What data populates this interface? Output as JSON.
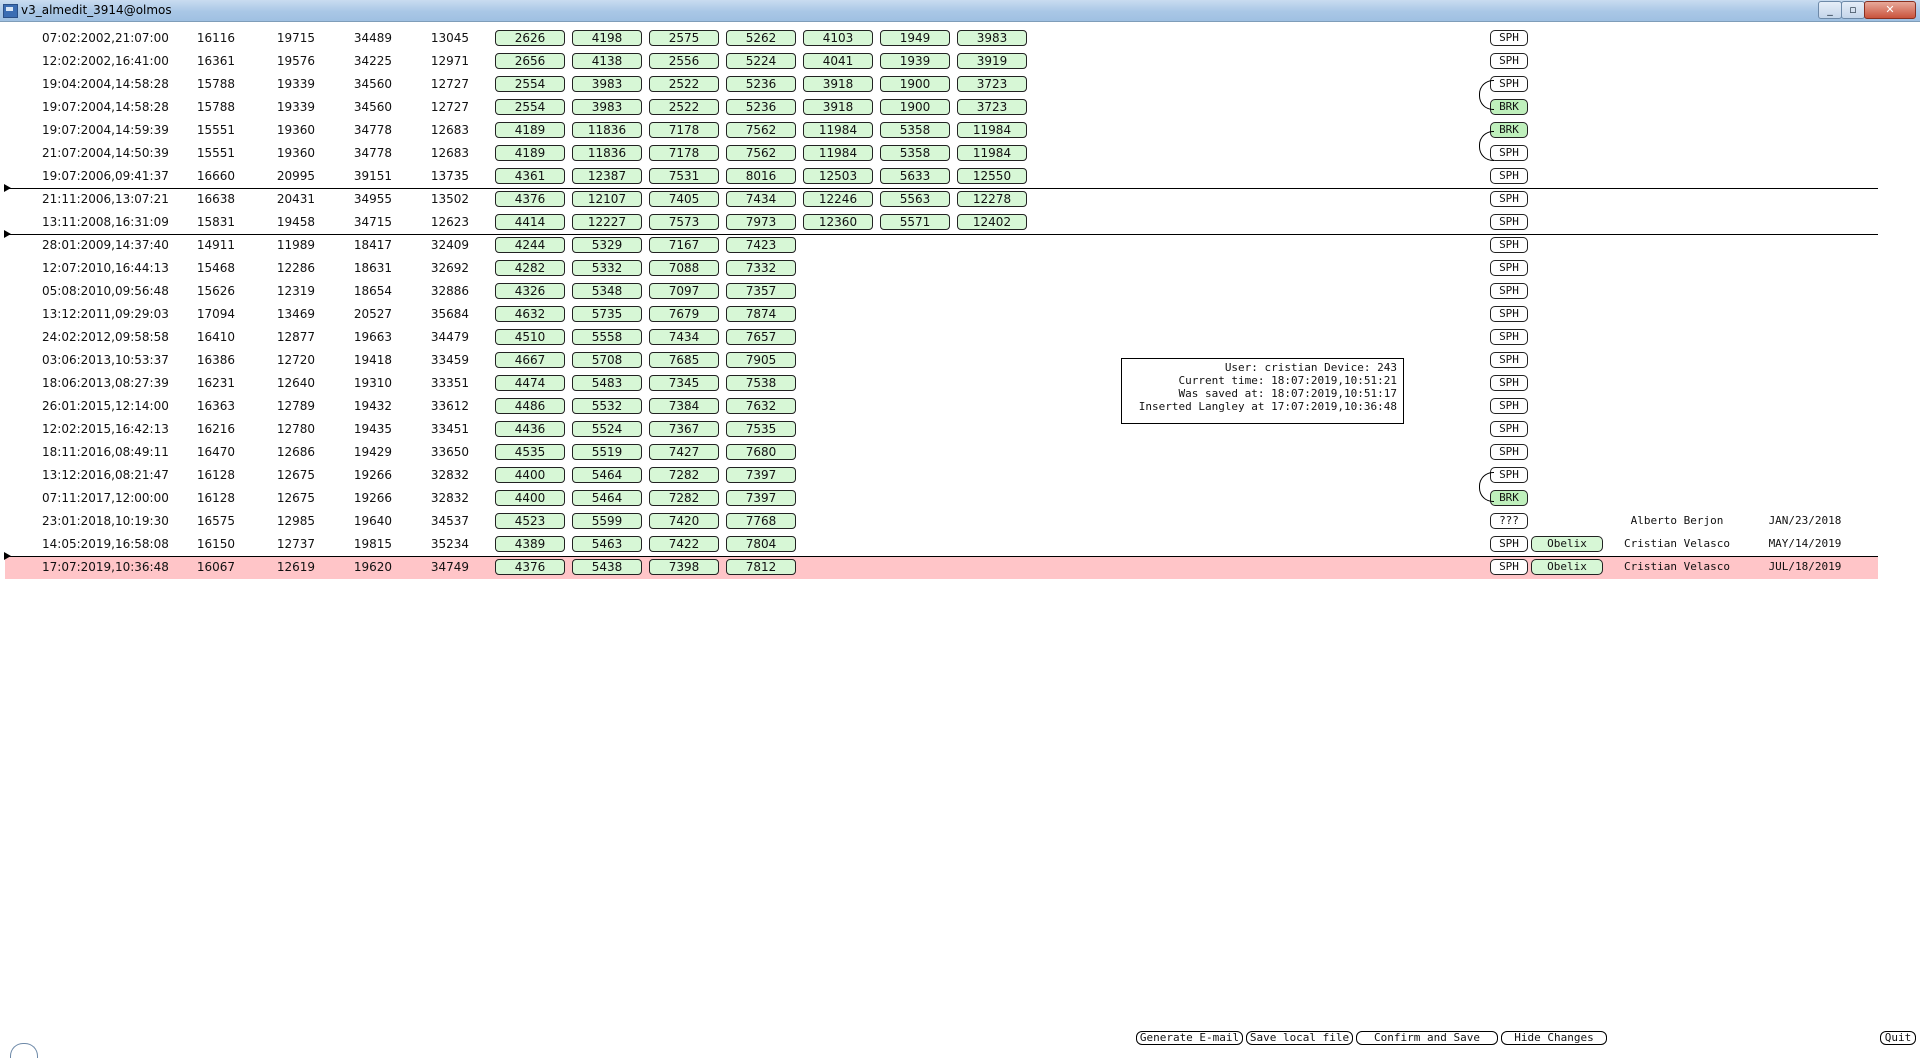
{
  "window": {
    "title": "v3_almedit_3914@olmos",
    "minimize": "_",
    "maximize": "▫",
    "close": "✕"
  },
  "rows": [
    {
      "date": "07:02:2002,21:07:00",
      "n": [
        "16116",
        "19715",
        "34489",
        "13045"
      ],
      "boxes": [
        "2626",
        "4198",
        "2575",
        "5262",
        "4103",
        "1949",
        "3983"
      ],
      "tag": "SPH"
    },
    {
      "date": "12:02:2002,16:41:00",
      "n": [
        "16361",
        "19576",
        "34225",
        "12971"
      ],
      "boxes": [
        "2656",
        "4138",
        "2556",
        "5224",
        "4041",
        "1939",
        "3919"
      ],
      "tag": "SPH"
    },
    {
      "date": "19:04:2004,14:58:28",
      "n": [
        "15788",
        "19339",
        "34560",
        "12727"
      ],
      "boxes": [
        "2554",
        "3983",
        "2522",
        "5236",
        "3918",
        "1900",
        "3723"
      ],
      "tag": "SPH"
    },
    {
      "date": "19:07:2004,14:58:28",
      "n": [
        "15788",
        "19339",
        "34560",
        "12727"
      ],
      "boxes": [
        "2554",
        "3983",
        "2522",
        "5236",
        "3918",
        "1900",
        "3723"
      ],
      "tag": "BRK"
    },
    {
      "date": "19:07:2004,14:59:39",
      "n": [
        "15551",
        "19360",
        "34778",
        "12683"
      ],
      "boxes": [
        "4189",
        "11836",
        "7178",
        "7562",
        "11984",
        "5358",
        "11984"
      ],
      "tag": "BRK"
    },
    {
      "date": "21:07:2004,14:50:39",
      "n": [
        "15551",
        "19360",
        "34778",
        "12683"
      ],
      "boxes": [
        "4189",
        "11836",
        "7178",
        "7562",
        "11984",
        "5358",
        "11984"
      ],
      "tag": "SPH"
    },
    {
      "date": "19:07:2006,09:41:37",
      "n": [
        "16660",
        "20995",
        "39151",
        "13735"
      ],
      "boxes": [
        "4361",
        "12387",
        "7531",
        "8016",
        "12503",
        "5633",
        "12550"
      ],
      "tag": "SPH"
    },
    {
      "date": "21:11:2006,13:07:21",
      "n": [
        "16638",
        "20431",
        "34955",
        "13502"
      ],
      "boxes": [
        "4376",
        "12107",
        "7405",
        "7434",
        "12246",
        "5563",
        "12278"
      ],
      "tag": "SPH"
    },
    {
      "date": "13:11:2008,16:31:09",
      "n": [
        "15831",
        "19458",
        "34715",
        "12623"
      ],
      "boxes": [
        "4414",
        "12227",
        "7573",
        "7973",
        "12360",
        "5571",
        "12402"
      ],
      "tag": "SPH"
    },
    {
      "date": "28:01:2009,14:37:40",
      "n": [
        "14911",
        "11989",
        "18417",
        "32409"
      ],
      "boxes": [
        "4244",
        "5329",
        "7167",
        "7423"
      ],
      "tag": "SPH"
    },
    {
      "date": "12:07:2010,16:44:13",
      "n": [
        "15468",
        "12286",
        "18631",
        "32692"
      ],
      "boxes": [
        "4282",
        "5332",
        "7088",
        "7332"
      ],
      "tag": "SPH"
    },
    {
      "date": "05:08:2010,09:56:48",
      "n": [
        "15626",
        "12319",
        "18654",
        "32886"
      ],
      "boxes": [
        "4326",
        "5348",
        "7097",
        "7357"
      ],
      "tag": "SPH"
    },
    {
      "date": "13:12:2011,09:29:03",
      "n": [
        "17094",
        "13469",
        "20527",
        "35684"
      ],
      "boxes": [
        "4632",
        "5735",
        "7679",
        "7874"
      ],
      "tag": "SPH"
    },
    {
      "date": "24:02:2012,09:58:58",
      "n": [
        "16410",
        "12877",
        "19663",
        "34479"
      ],
      "boxes": [
        "4510",
        "5558",
        "7434",
        "7657"
      ],
      "tag": "SPH"
    },
    {
      "date": "03:06:2013,10:53:37",
      "n": [
        "16386",
        "12720",
        "19418",
        "33459"
      ],
      "boxes": [
        "4667",
        "5708",
        "7685",
        "7905"
      ],
      "tag": "SPH"
    },
    {
      "date": "18:06:2013,08:27:39",
      "n": [
        "16231",
        "12640",
        "19310",
        "33351"
      ],
      "boxes": [
        "4474",
        "5483",
        "7345",
        "7538"
      ],
      "tag": "SPH"
    },
    {
      "date": "26:01:2015,12:14:00",
      "n": [
        "16363",
        "12789",
        "19432",
        "33612"
      ],
      "boxes": [
        "4486",
        "5532",
        "7384",
        "7632"
      ],
      "tag": "SPH"
    },
    {
      "date": "12:02:2015,16:42:13",
      "n": [
        "16216",
        "12780",
        "19435",
        "33451"
      ],
      "boxes": [
        "4436",
        "5524",
        "7367",
        "7535"
      ],
      "tag": "SPH"
    },
    {
      "date": "18:11:2016,08:49:11",
      "n": [
        "16470",
        "12686",
        "19429",
        "33650"
      ],
      "boxes": [
        "4535",
        "5519",
        "7427",
        "7680"
      ],
      "tag": "SPH"
    },
    {
      "date": "13:12:2016,08:21:47",
      "n": [
        "16128",
        "12675",
        "19266",
        "32832"
      ],
      "boxes": [
        "4400",
        "5464",
        "7282",
        "7397"
      ],
      "tag": "SPH"
    },
    {
      "date": "07:11:2017,12:00:00",
      "n": [
        "16128",
        "12675",
        "19266",
        "32832"
      ],
      "boxes": [
        "4400",
        "5464",
        "7282",
        "7397"
      ],
      "tag": "BRK"
    },
    {
      "date": "23:01:2018,10:19:30",
      "n": [
        "16575",
        "12985",
        "19640",
        "34537"
      ],
      "boxes": [
        "4523",
        "5599",
        "7420",
        "7768"
      ],
      "tag": "???",
      "who": "Alberto Berjon",
      "when": "JAN/23/2018"
    },
    {
      "date": "14:05:2019,16:58:08",
      "n": [
        "16150",
        "12737",
        "19815",
        "35234"
      ],
      "boxes": [
        "4389",
        "5463",
        "7422",
        "7804"
      ],
      "tag": "SPH",
      "obelix": "Obelix",
      "who": "Cristian Velasco",
      "when": "MAY/14/2019"
    },
    {
      "date": "17:07:2019,10:36:48",
      "n": [
        "16067",
        "12619",
        "19620",
        "34749"
      ],
      "boxes": [
        "4376",
        "5438",
        "7398",
        "7812"
      ],
      "tag": "SPH",
      "obelix": "Obelix",
      "who": "Cristian Velasco",
      "when": "JUL/18/2019",
      "highlight": true
    }
  ],
  "info": {
    "line1": "User: cristian Device: 243",
    "line2": "Current time: 18:07:2019,10:51:21",
    "line3": "Was saved at: 18:07:2019,10:51:17",
    "line4": "Inserted Langley at 17:07:2019,10:36:48"
  },
  "buttons": {
    "email": "Generate E-mail",
    "save_local": "Save local file",
    "confirm": "Confirm and Save",
    "hide": "Hide Changes",
    "quit": "Quit"
  }
}
